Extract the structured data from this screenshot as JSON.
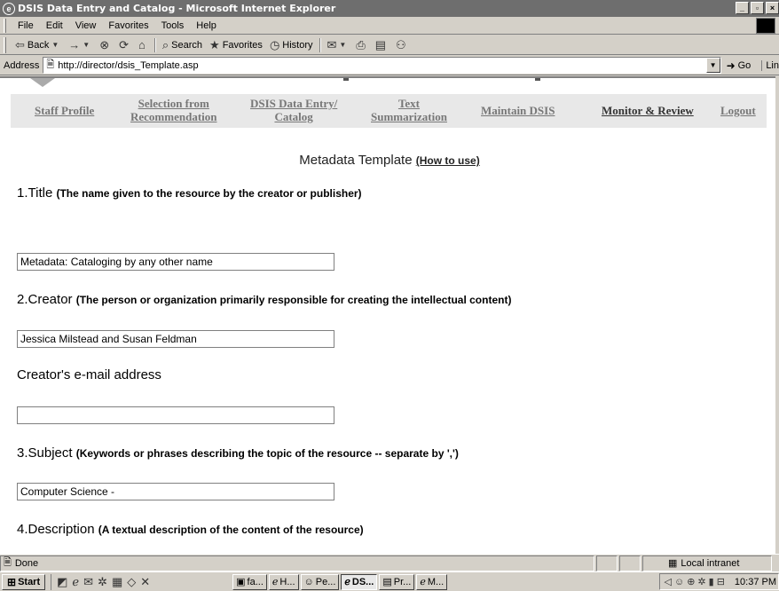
{
  "window": {
    "title": "DSIS Data Entry and Catalog - Microsoft Internet Explorer",
    "controls": [
      "_",
      "▫",
      "×"
    ]
  },
  "menu": [
    "File",
    "Edit",
    "View",
    "Favorites",
    "Tools",
    "Help"
  ],
  "toolbar": {
    "back": "Back",
    "forward_icon": "→",
    "search": "Search",
    "favorites": "Favorites",
    "history": "History"
  },
  "address": {
    "label": "Address",
    "url": "http://director/dsis_Template.asp",
    "go": "Go",
    "links": "Lin"
  },
  "nav": {
    "items": [
      {
        "label": "Staff Profile"
      },
      {
        "label": "Selection from",
        "label2": "Recommendation"
      },
      {
        "label": "DSIS Data Entry/",
        "label2": "Catalog"
      },
      {
        "label": "Text",
        "label2": "Summarization"
      },
      {
        "label": "Maintain DSIS"
      },
      {
        "label": "Monitor & Review"
      },
      {
        "label": "Logout"
      }
    ]
  },
  "page": {
    "heading": "Metadata Template",
    "howto": "(How to use)",
    "fields": [
      {
        "label": "1.Title",
        "desc": "(The name given to the resource by the creator or publisher)",
        "value": "Metadata: Cataloging by any other name"
      },
      {
        "label": "2.Creator",
        "desc": "(The person or organization primarily responsible for creating the intellectual content)",
        "value": "Jessica Milstead and Susan Feldman"
      },
      {
        "label": "Creator's e-mail address",
        "desc": "",
        "value": ""
      },
      {
        "label": "3.Subject",
        "desc": "(Keywords or phrases describing the topic of the resource --  separate by ',')",
        "value": "Computer Science -"
      },
      {
        "label": "4.Description",
        "desc": "(A textual description of the content of the resource)",
        "value": null
      }
    ]
  },
  "status": {
    "text": "Done",
    "zone": "Local intranet"
  },
  "taskbar": {
    "start": "Start",
    "tasks": [
      "fa...",
      "H...",
      "Pe...",
      "DS...",
      "Pr...",
      "M..."
    ],
    "clock": "10:37 PM"
  }
}
